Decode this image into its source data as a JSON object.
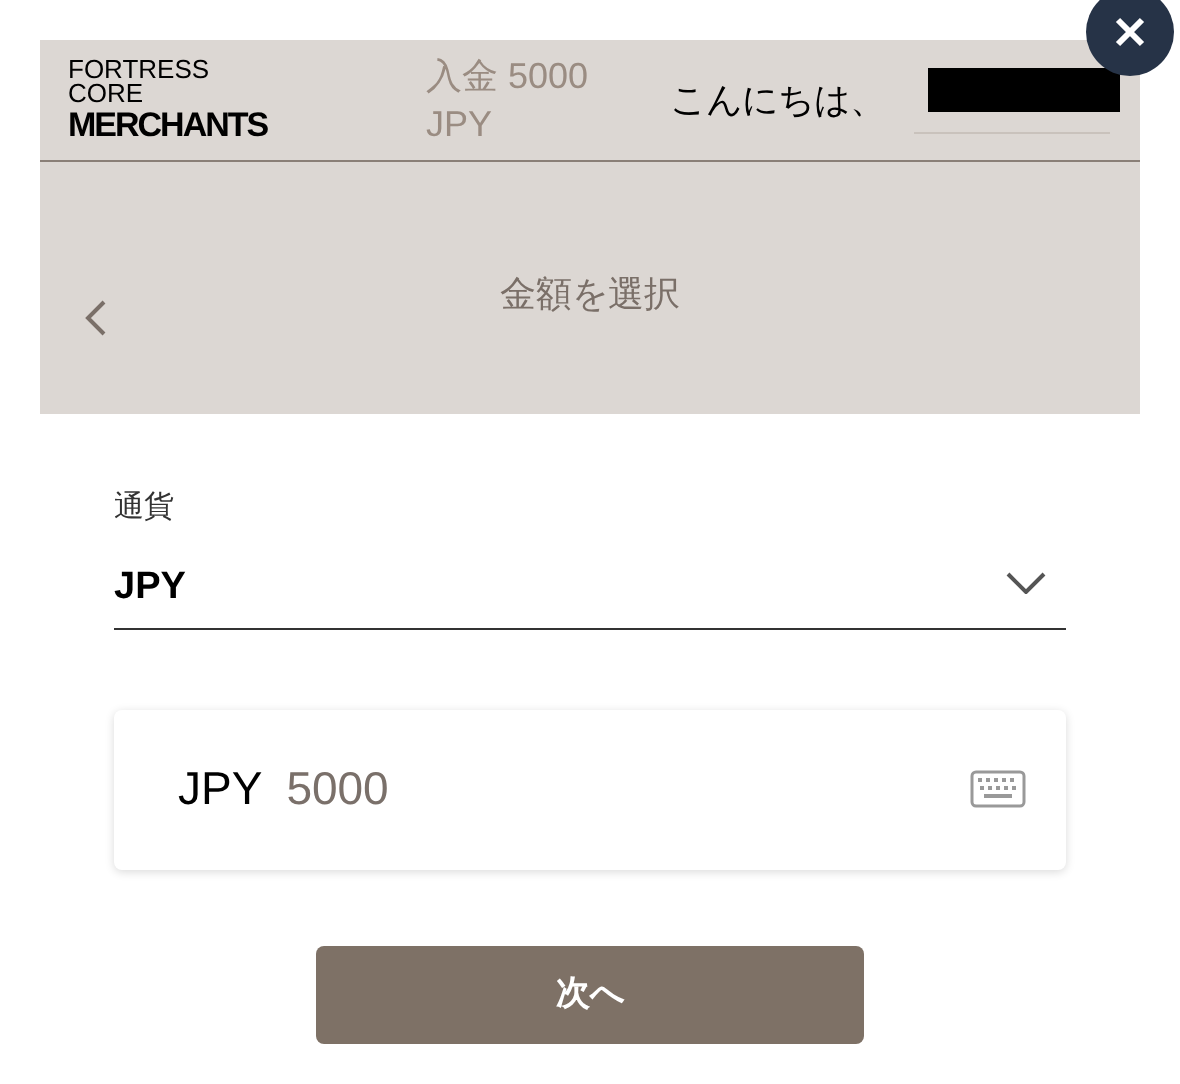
{
  "header": {
    "logo": [
      "FORTRESS",
      "CORE",
      "MERCHANTS"
    ],
    "title": "入金 5000 JPY",
    "greeting": "こんにちは、"
  },
  "step": {
    "title": "金額を選択"
  },
  "currency": {
    "label": "通貨",
    "value": "JPY"
  },
  "amount": {
    "currency": "JPY",
    "value": "5000"
  },
  "buttons": [
    "次へ"
  ]
}
